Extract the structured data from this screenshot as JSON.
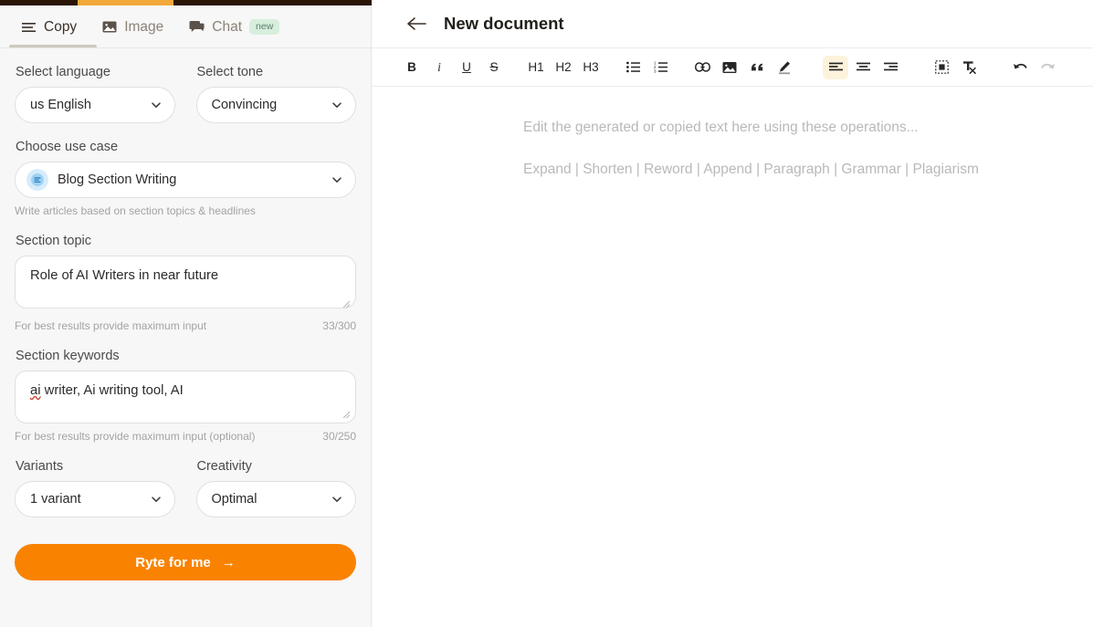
{
  "tabs": [
    {
      "label": "Copy",
      "icon": "menu-icon",
      "active": true,
      "badge": ""
    },
    {
      "label": "Image",
      "icon": "image-icon",
      "active": false,
      "badge": ""
    },
    {
      "label": "Chat",
      "icon": "chat-icon",
      "active": false,
      "badge": "new"
    }
  ],
  "sidebar": {
    "language": {
      "label": "Select language",
      "value": "us English"
    },
    "tone": {
      "label": "Select tone",
      "value": "Convincing"
    },
    "use_case": {
      "label": "Choose use case",
      "value": "Blog Section Writing",
      "icon": "document-lines-icon",
      "description": "Write articles based on section topics & headlines"
    },
    "section_topic": {
      "label": "Section topic",
      "value": "Role of AI Writers in near future",
      "hint": "For best results provide maximum input",
      "counter": "33/300"
    },
    "section_keywords": {
      "label": "Section keywords",
      "value_misspelled": "ai",
      "value_rest": " writer, Ai writing tool, AI",
      "hint": "For best results provide maximum input (optional)",
      "counter": "30/250"
    },
    "variants": {
      "label": "Variants",
      "value": "1 variant"
    },
    "creativity": {
      "label": "Creativity",
      "value": "Optimal"
    },
    "submit": {
      "label": "Ryte for me",
      "arrow": "→"
    }
  },
  "document": {
    "back_icon": "arrow-left-icon",
    "title": "New document",
    "toolbar": [
      {
        "name": "bold",
        "label": "B",
        "type": "text",
        "active": false
      },
      {
        "name": "italic",
        "label": "i",
        "type": "text",
        "active": false
      },
      {
        "name": "underline",
        "label": "U",
        "type": "text",
        "active": false
      },
      {
        "name": "strikethrough",
        "label": "S",
        "type": "text",
        "active": false
      },
      {
        "name": "heading-1",
        "label": "H1",
        "type": "text",
        "active": false
      },
      {
        "name": "heading-2",
        "label": "H2",
        "type": "text",
        "active": false
      },
      {
        "name": "heading-3",
        "label": "H3",
        "type": "text",
        "active": false
      },
      {
        "name": "bullet-list",
        "label": "",
        "type": "icon",
        "active": false
      },
      {
        "name": "numbered-list",
        "label": "",
        "type": "icon",
        "active": false
      },
      {
        "name": "link",
        "label": "",
        "type": "icon",
        "active": false
      },
      {
        "name": "image",
        "label": "",
        "type": "icon",
        "active": false
      },
      {
        "name": "blockquote",
        "label": "",
        "type": "icon",
        "active": false
      },
      {
        "name": "highlighter-pen",
        "label": "",
        "type": "icon",
        "active": false
      },
      {
        "name": "align-left",
        "label": "",
        "type": "icon",
        "active": true
      },
      {
        "name": "align-center",
        "label": "",
        "type": "icon",
        "active": false
      },
      {
        "name": "align-right",
        "label": "",
        "type": "icon",
        "active": false
      },
      {
        "name": "insert-box",
        "label": "",
        "type": "icon",
        "active": false
      },
      {
        "name": "clear-formatting",
        "label": "",
        "type": "icon",
        "active": false
      },
      {
        "name": "undo",
        "label": "",
        "type": "icon",
        "active": false
      },
      {
        "name": "redo",
        "label": "",
        "type": "icon",
        "active": false,
        "disabled": true
      }
    ],
    "placeholder_main": "Edit the generated or copied text here using these operations...",
    "placeholder_ops": "Expand | Shorten | Reword | Append | Paragraph | Grammar | Plagiarism"
  },
  "colors": {
    "accent_orange": "#f98300",
    "top_bar_dark": "#2a1505",
    "progress_orange": "#f2a83a",
    "badge_green_bg": "#d7eedd",
    "active_tool_bg": "#fdf3dc",
    "use_case_icon_bg": "#d6ecfb"
  }
}
